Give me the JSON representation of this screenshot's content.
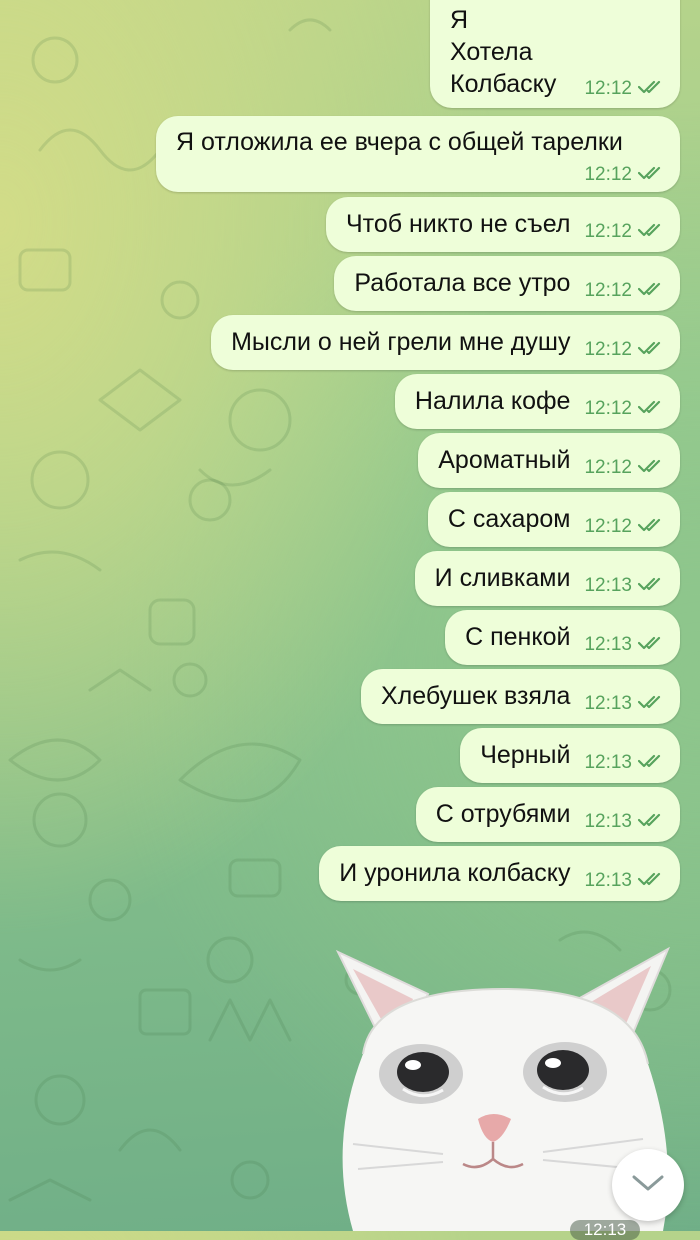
{
  "chat": {
    "messages": [
      {
        "lines": [
          "Я",
          "Хотела",
          "Колбаску"
        ],
        "time": "12:12",
        "status": "read"
      },
      {
        "text": "Я отложила ее вчера с общей тарелки",
        "time": "12:12",
        "status": "read"
      },
      {
        "text": "Чтоб никто не съел",
        "time": "12:12",
        "status": "read"
      },
      {
        "text": "Работала все утро",
        "time": "12:12",
        "status": "read"
      },
      {
        "text": "Мысли о ней грели мне душу",
        "time": "12:12",
        "status": "read"
      },
      {
        "text": "Налила кофе",
        "time": "12:12",
        "status": "read"
      },
      {
        "text": "Ароматный",
        "time": "12:12",
        "status": "read"
      },
      {
        "text": "С сахаром",
        "time": "12:12",
        "status": "read"
      },
      {
        "text": "И сливками",
        "time": "12:13",
        "status": "read"
      },
      {
        "text": "С пенкой",
        "time": "12:13",
        "status": "read"
      },
      {
        "text": "Хлебушек взяла",
        "time": "12:13",
        "status": "read"
      },
      {
        "text": "Черный",
        "time": "12:13",
        "status": "read"
      },
      {
        "text": "С отрубями",
        "time": "12:13",
        "status": "read"
      },
      {
        "text": "И уронила колбаску",
        "time": "12:13",
        "status": "read"
      }
    ],
    "sticker": {
      "subject": "crying white cat",
      "time": "12:13"
    }
  },
  "icons": {
    "read_status": "double-check-icon",
    "scroll_down": "chevron-down-icon"
  },
  "colors": {
    "bubble": "#eefed9",
    "meta": "#57a35d",
    "text": "#111111"
  }
}
